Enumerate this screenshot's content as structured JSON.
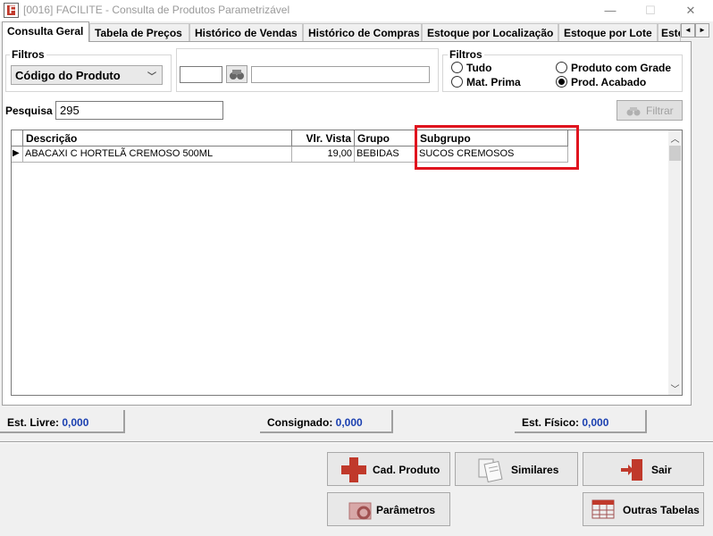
{
  "window": {
    "title": "[0016] FACILITE - Consulta de Produtos Parametrizável",
    "controls": [
      "—",
      "☐",
      "✕"
    ]
  },
  "tabs": [
    {
      "label": "Consulta Geral",
      "active": true
    },
    {
      "label": "Tabela de Preços"
    },
    {
      "label": "Histórico de Vendas"
    },
    {
      "label": "Histórico de Compras"
    },
    {
      "label": "Estoque por Localização"
    },
    {
      "label": "Estoque por Lote"
    },
    {
      "label": "Este"
    }
  ],
  "tab_scroll": {
    "left": "◄",
    "right": "►"
  },
  "filters_left": {
    "label": "Filtros",
    "select_value": "Código do Produto",
    "chevron": "﹀"
  },
  "filters_middle": {
    "input1": "",
    "input2": ""
  },
  "filters_right": {
    "label": "Filtros",
    "options": [
      {
        "label": "Tudo",
        "checked": false
      },
      {
        "label": "Produto com Grade",
        "checked": false
      },
      {
        "label": "Mat. Prima",
        "checked": false
      },
      {
        "label": "Prod. Acabado",
        "checked": true
      }
    ]
  },
  "search": {
    "label": "Pesquisa",
    "value": "295",
    "filter_button": "Filtrar"
  },
  "grid": {
    "columns": [
      "Descrição",
      "Vlr. Vista",
      "Grupo",
      "Subgrupo"
    ],
    "rows": [
      {
        "indicator": "▶",
        "descricao": "ABACAXI C HORTELÃ CREMOSO 500ML",
        "vlr_vista": "19,00",
        "grupo": "BEBIDAS",
        "subgrupo": "SUCOS CREMOSOS"
      }
    ],
    "scroll_up": "︿",
    "scroll_down": "﹀"
  },
  "status": {
    "est_livre_label": "Est. Livre:",
    "est_livre_value": "0,000",
    "consignado_label": "Consignado:",
    "consignado_value": "0,000",
    "est_fisico_label": "Est. Físico:",
    "est_fisico_value": "0,000"
  },
  "buttons": {
    "cad_produto": "Cad. Produto",
    "similares": "Similares",
    "sair": "Sair",
    "parametros": "Parâmetros",
    "outras_tabelas": "Outras Tabelas"
  },
  "colors": {
    "accent_red": "#e0141e",
    "status_value_blue": "#1a3fb0"
  }
}
